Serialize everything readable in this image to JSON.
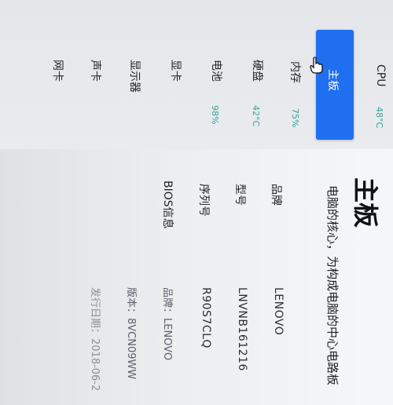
{
  "sidebar": {
    "items": [
      {
        "label": "CPU",
        "value": "48°C"
      },
      {
        "label": "主板",
        "value": ""
      },
      {
        "label": "内存",
        "value": "75%"
      },
      {
        "label": "硬盘",
        "value": "42°C"
      },
      {
        "label": "电池",
        "value": "98%"
      },
      {
        "label": "显卡",
        "value": ""
      },
      {
        "label": "显示器",
        "value": ""
      },
      {
        "label": "声卡",
        "value": ""
      },
      {
        "label": "网卡",
        "value": ""
      }
    ],
    "active_index": 1
  },
  "main": {
    "title": "主板",
    "description": "电脑的核心，为构成电脑的中心电路板",
    "fields": [
      {
        "label": "品牌",
        "value": "LENOVO"
      },
      {
        "label": "型号",
        "value": "LNVNB161216"
      },
      {
        "label": "序列号",
        "value": "R90S7CLQ"
      },
      {
        "label": "BIOS信息",
        "sub": [
          "品牌：LENOVO",
          "版本：8VCN09WW",
          "发行日期：2018-06-2"
        ]
      }
    ]
  },
  "colors": {
    "accent": "#1f6ff0",
    "value_green": "#35a397"
  }
}
